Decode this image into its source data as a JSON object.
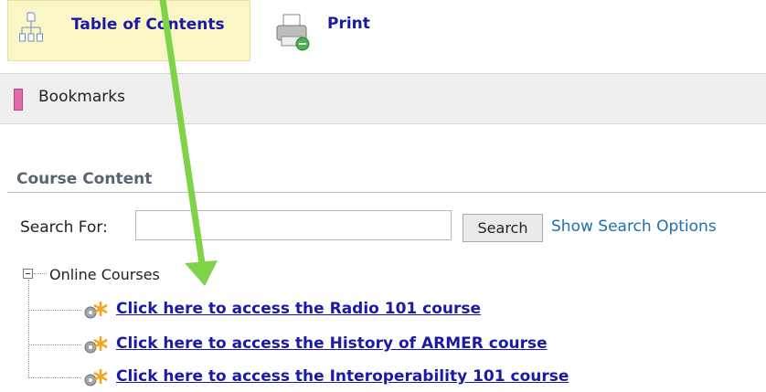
{
  "toolbar": {
    "toc_label": "Table of Contents",
    "print_label": "Print"
  },
  "bookmarks": {
    "label": "Bookmarks"
  },
  "course_content": {
    "title": "Course Content",
    "search_label": "Search For:",
    "search_value": "",
    "search_button": "Search",
    "show_options": "Show Search Options"
  },
  "tree": {
    "folder": "Online Courses",
    "items": [
      {
        "label": "Click here to access the Radio 101 course"
      },
      {
        "label": "Click here to access the History of ARMER course"
      },
      {
        "label": "Click here to access the Interoperability 101 course"
      }
    ]
  },
  "colors": {
    "link": "#1a1aa6",
    "toc_highlight": "#fbf6c6",
    "annotation_arrow": "#7ed348",
    "bookmark_icon": "#e46ab0"
  }
}
